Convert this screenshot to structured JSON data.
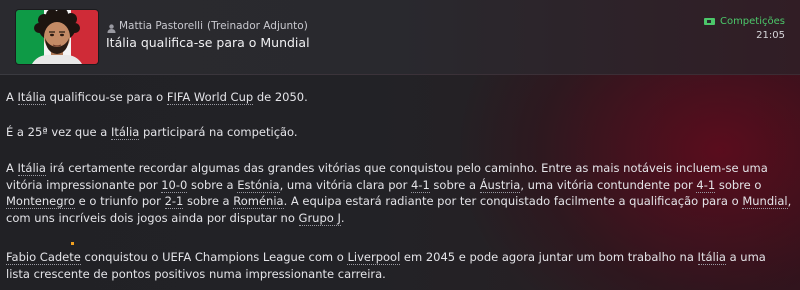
{
  "header": {
    "sender_name": "Mattia Pastorelli",
    "sender_role": "(Treinador Adjunto)",
    "subject": "Itália qualifica-se para o Mundial",
    "category": "Competições",
    "time": "21:05"
  },
  "colors": {
    "flag_green": "#0e9a46",
    "flag_white": "#f3f3f3",
    "flag_red": "#cf2b37",
    "category_green": "#4cc76a",
    "accent_red": "#620a1c"
  },
  "icons": {
    "person": "person-icon",
    "category": "tag-icon"
  },
  "body": {
    "p1": {
      "t1": "A ",
      "l1": "Itália",
      "t2": " qualificou-se para o ",
      "l2": "FIFA World Cup",
      "t3": " de 2050."
    },
    "p2": {
      "t1": "É a 25ª vez que a ",
      "l1": "Itália",
      "t2": " participará na competição."
    },
    "p3": {
      "t1": "A ",
      "l1": "Itália",
      "t2": " irá certamente recordar algumas das grandes vitórias que conquistou pelo caminho. Entre as mais notáveis incluem-se uma vitória impressionante por ",
      "l2": "10-0",
      "t3": " sobre a ",
      "l3": "Estónia",
      "t4": ", uma vitória clara por ",
      "l4": "4-1",
      "t5": " sobre a ",
      "l5": "Áustria",
      "t6": ", uma vitória contundente por ",
      "l6": "4-1",
      "t7": " sobre o ",
      "l7": "Montenegro",
      "t8": " e o triunfo por ",
      "l8": "2-1",
      "t9": " sobre a ",
      "l9": "Roménia",
      "t10": ". A equipa estará radiante por ter conquistado facilmente a qualificação para o ",
      "l10": "Mundial",
      "t11": ", com uns incríveis dois jogos ainda por disputar no ",
      "l11": "Grupo J",
      "t12": "."
    },
    "p4": {
      "l1": "Fabio Cadete",
      "t1": " conquistou o ",
      "l2": "UEFA Champions League",
      "t2": " com o ",
      "l3": "Liverpool",
      "t3": " em 2045 e pode agora juntar um bom trabalho na ",
      "l4": "Itália",
      "t4": " a uma lista crescente de pontos positivos numa impressionante carreira."
    }
  }
}
